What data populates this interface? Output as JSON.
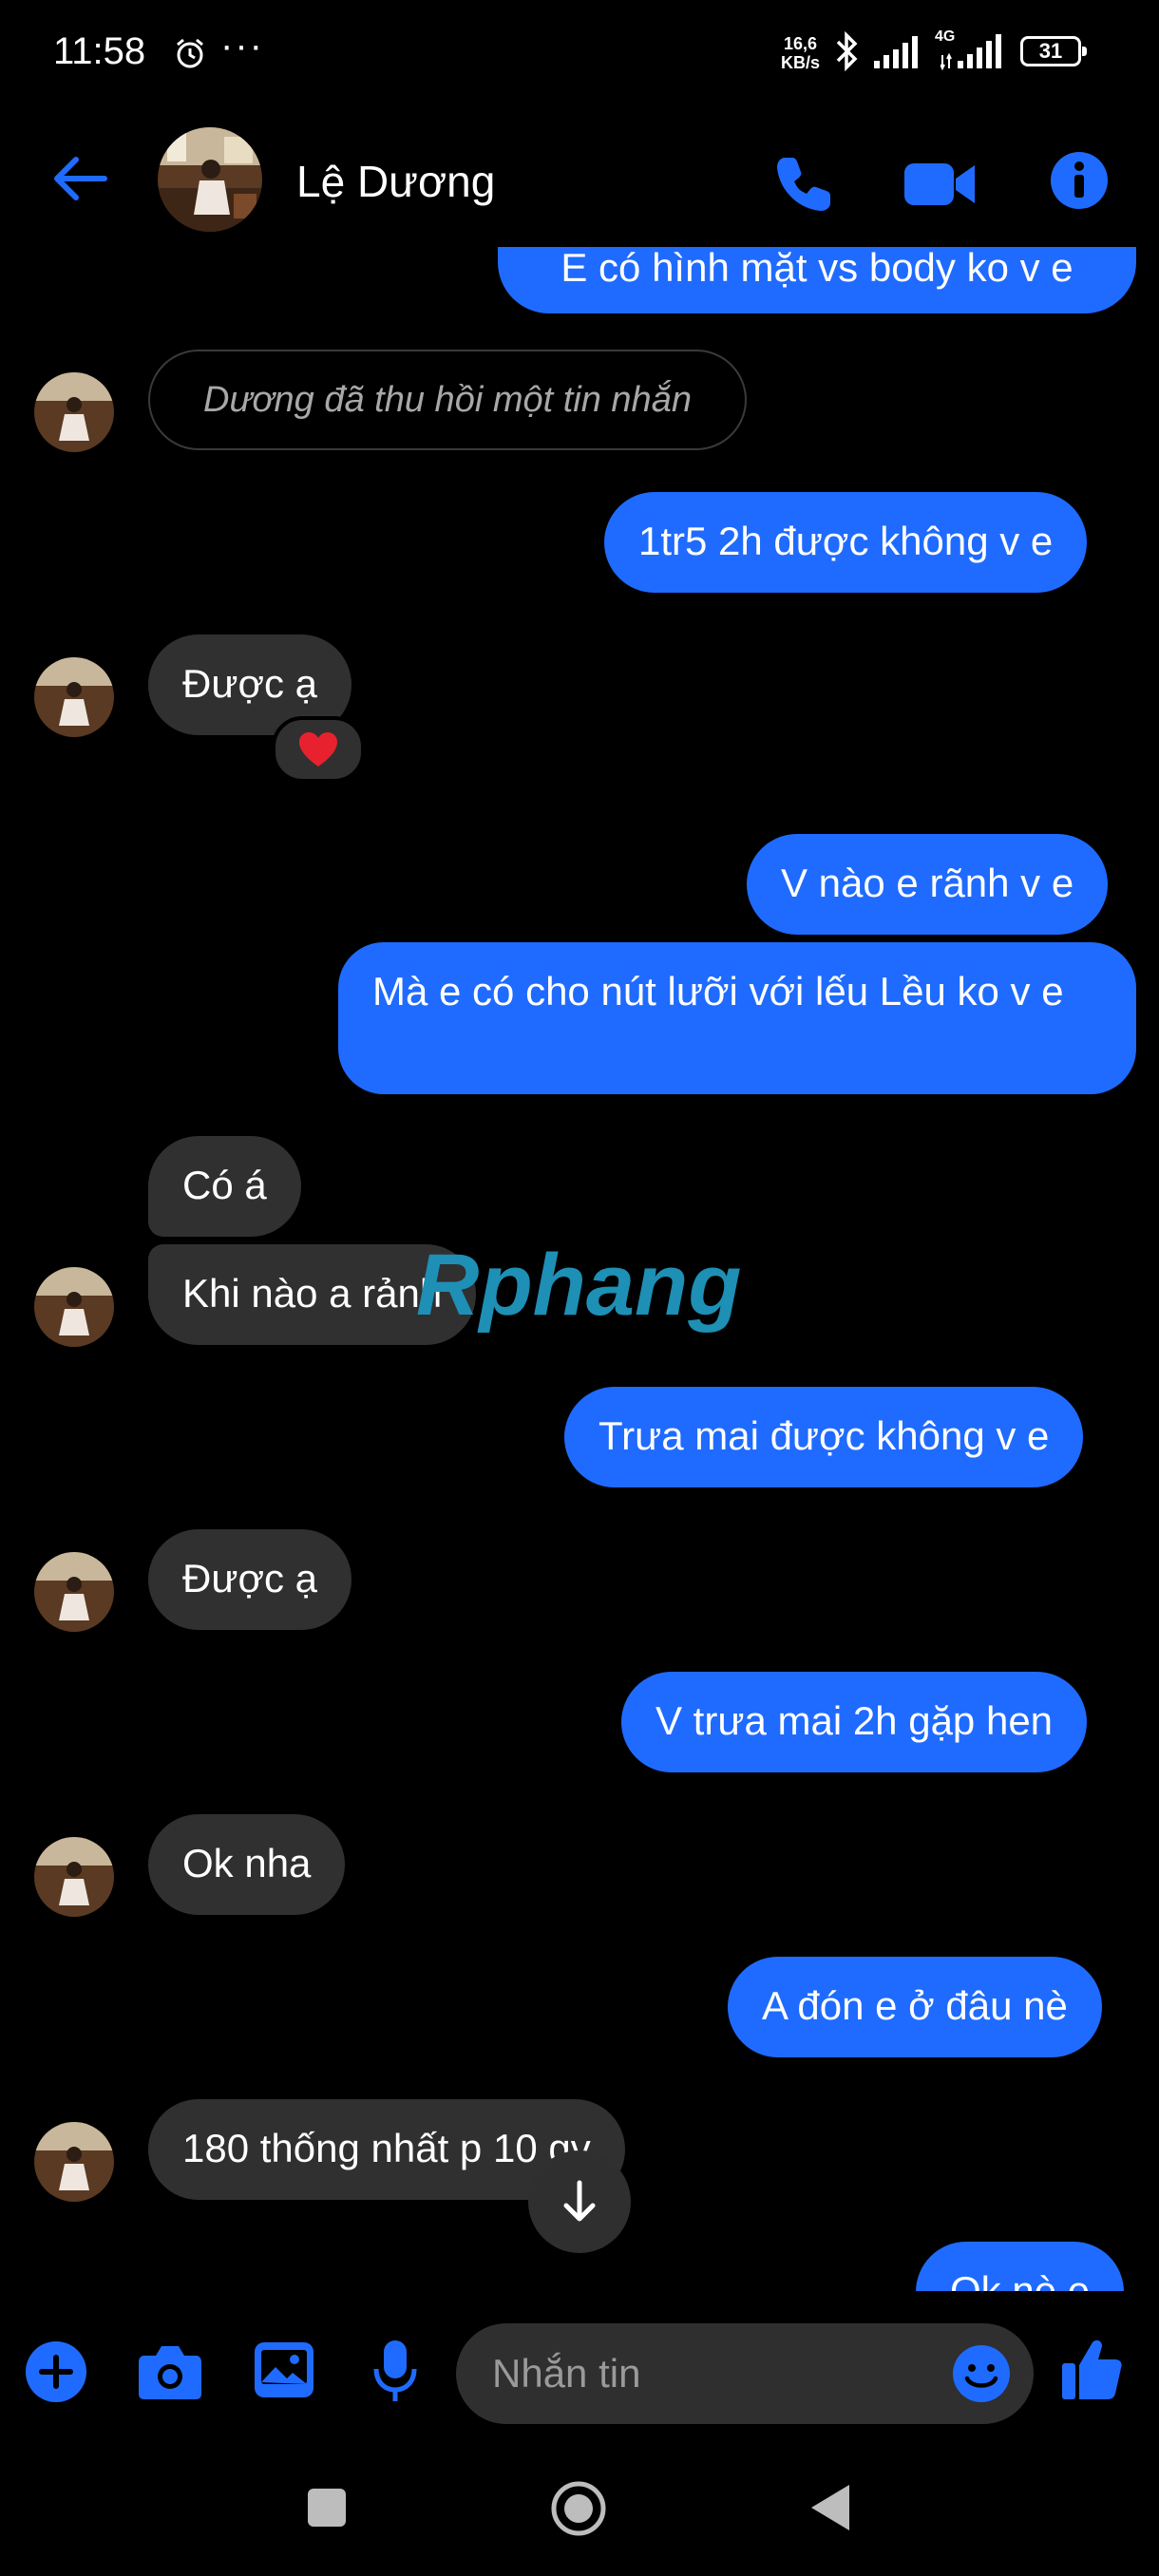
{
  "status_bar": {
    "time": "11:58",
    "dots": "···",
    "speed_value": "16,6",
    "speed_unit": "KB/s",
    "network": "4G",
    "battery": "31"
  },
  "header": {
    "contact_name": "Lệ Dương"
  },
  "messages": {
    "partial_top": "E có hình mặt vs body ko v e",
    "unsent_notice": "Dương đã thu hồi một tin nhắn",
    "m1": "1tr5 2h được không v e",
    "m2": "Được ạ",
    "m2_reaction": "heart",
    "m3": "V nào e rãnh v e",
    "m4": "Mà e có cho nút lưỡi với lếu Lều ko v e",
    "m5": "Có á",
    "m6": "Khi nào a rảnh",
    "m7": "Trưa mai được không v e",
    "m8": "Được ạ",
    "m9": "V trưa mai 2h gặp hen",
    "m10": "Ok nha",
    "m11": "A đón e ở đâu nè",
    "m12": "180 thống nhất p 10 gv",
    "m13": "Ok nè e"
  },
  "composer": {
    "placeholder": "Nhắn tin"
  },
  "watermark": "Rphang",
  "colors": {
    "accent": "#1f6bff",
    "incoming_bubble": "#303030",
    "background": "#000000"
  }
}
